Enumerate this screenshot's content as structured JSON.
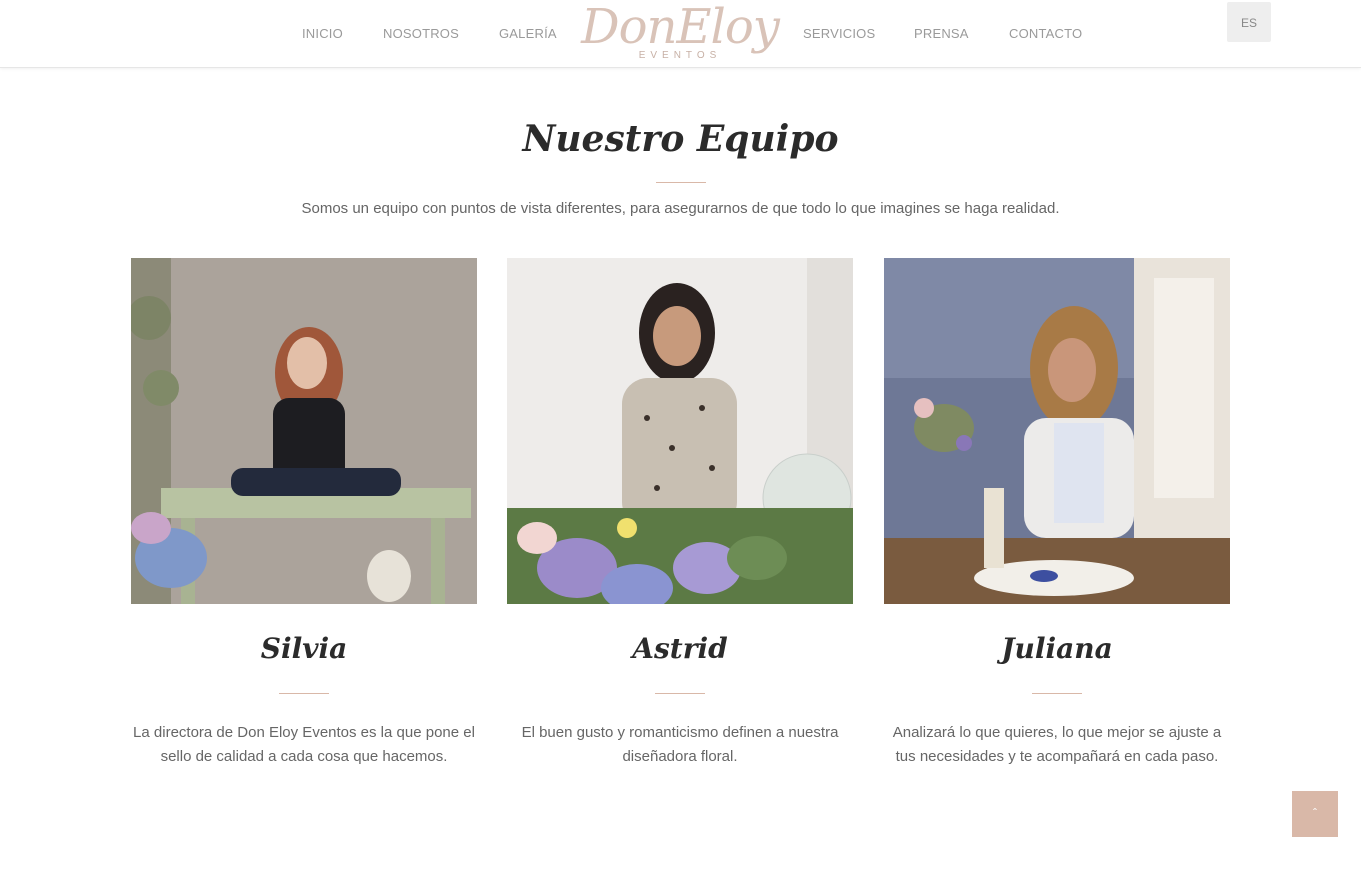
{
  "nav": {
    "left": [
      "INICIO",
      "NOSOTROS",
      "GALERÍA"
    ],
    "right": [
      "SERVICIOS",
      "PRENSA",
      "CONTACTO"
    ],
    "language": "ES"
  },
  "logo": {
    "script": "DonEloy",
    "sub": "EVENTOS"
  },
  "section": {
    "title": "Nuestro Equipo",
    "subtitle": "Somos un equipo con puntos de vista diferentes, para asegurarnos de que todo lo que imagines se haga realidad."
  },
  "team": [
    {
      "name": "Silvia",
      "description": "La directora de Don Eloy Eventos es la que pone el sello de calidad a cada cosa que hacemos."
    },
    {
      "name": "Astrid",
      "description": "El buen gusto y romanticismo definen a nuestra diseñadora floral."
    },
    {
      "name": "Juliana",
      "description": "Analizará lo que quieres, lo que mejor se ajuste a tus necesidades y te acompañará en cada paso."
    }
  ],
  "scroll_top": {
    "icon": "chevron-up-icon",
    "glyph": "ˆ"
  },
  "colors": {
    "accent": "#d9b8a8",
    "text": "#666666",
    "heading": "#2b2b2b",
    "nav": "#9a9a9a"
  }
}
